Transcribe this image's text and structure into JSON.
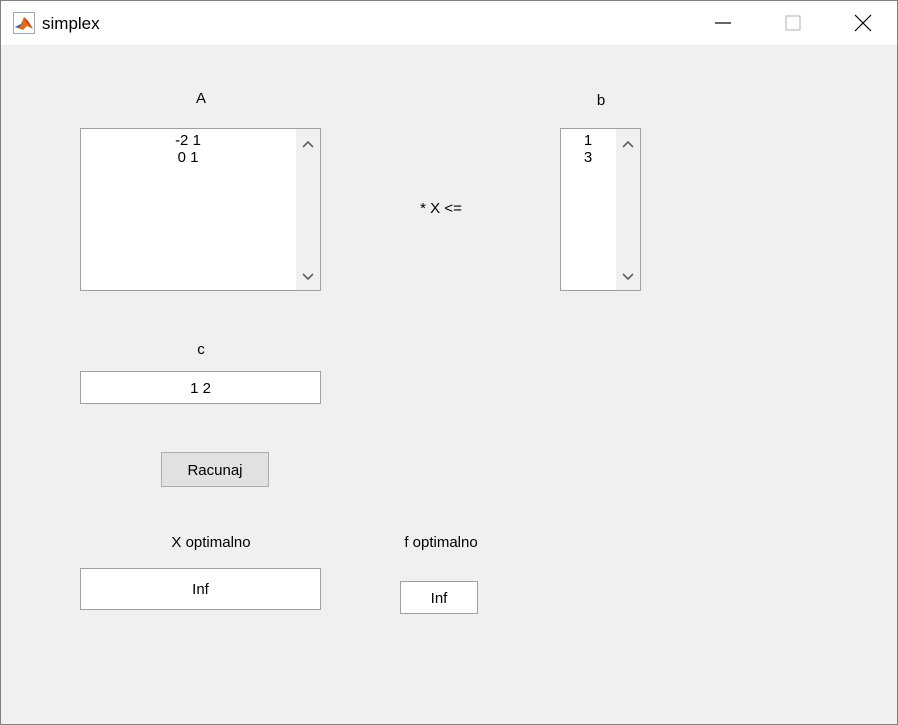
{
  "window": {
    "title": "simplex"
  },
  "labels": {
    "A": "A",
    "b": "b",
    "operator": "* X <=",
    "c": "c",
    "x_opt": "X optimalno",
    "f_opt": "f optimalno"
  },
  "fields": {
    "A_value": "-2 1\n0 1",
    "b_value": "1\n3",
    "c_value": "1 2",
    "x_opt_value": "Inf",
    "f_opt_value": "Inf"
  },
  "buttons": {
    "compute": "Racunaj"
  }
}
